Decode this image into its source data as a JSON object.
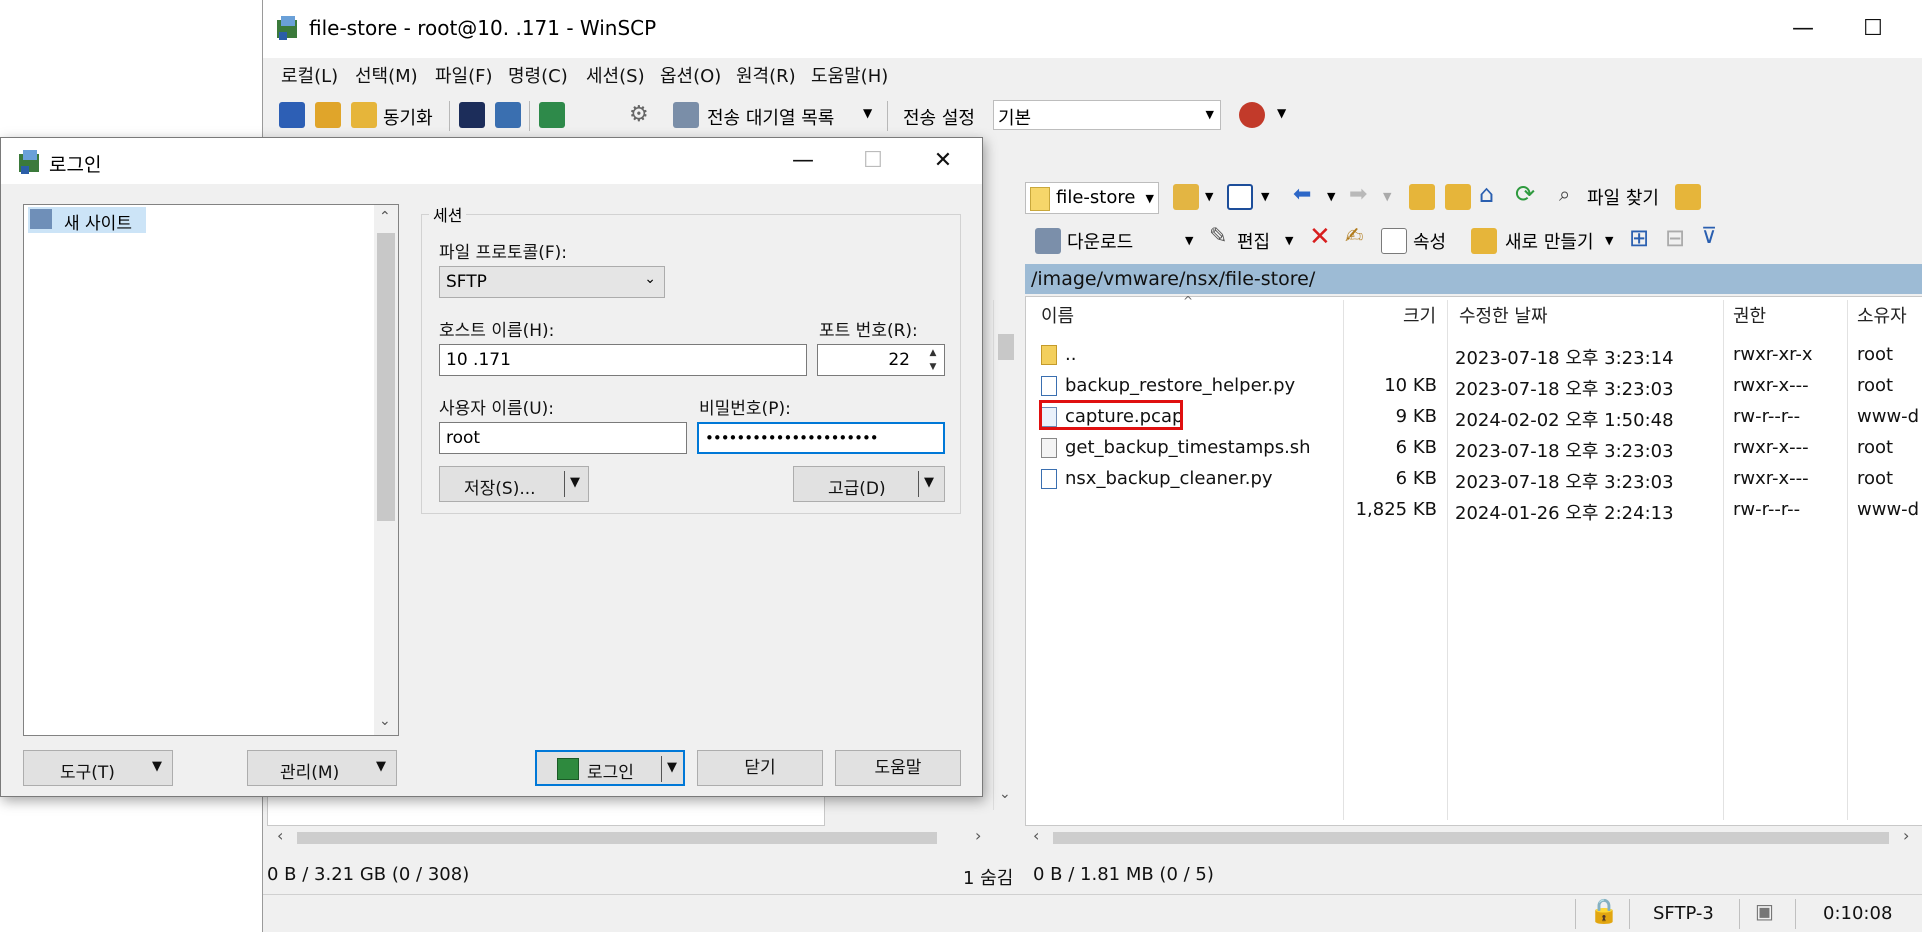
{
  "window": {
    "title": "file-store - root@10.          .171 - WinSCP",
    "minimize": "—",
    "maximize": "☐",
    "close": "✕"
  },
  "menu": [
    "로컬(L)",
    "선택(M)",
    "파일(F)",
    "명령(C)",
    "세션(S)",
    "옵션(O)",
    "원격(R)",
    "도움말(H)"
  ],
  "toolbar": {
    "sync_label": "동기화",
    "queue_label": "전송 대기열 목록",
    "transfer_settings_label": "전송 설정",
    "transfer_settings_value": "기본"
  },
  "remote": {
    "folder": "file-store",
    "find_files": "파일 찾기",
    "download": "다운로드",
    "edit": "편집",
    "properties": "속성",
    "new": "새로 만들기",
    "path": "/image/vmware/nsx/file-store/",
    "columns": {
      "name": "이름",
      "size": "크기",
      "modified": "수정한 날짜",
      "rights": "권한",
      "owner": "소유자"
    },
    "files": [
      {
        "name": "..",
        "size": "",
        "modified": "2023-07-18 오후 3:23:14",
        "rights": "rwxr-xr-x",
        "owner": "root",
        "icon": "parent-folder-icon"
      },
      {
        "name": "backup_restore_helper.py",
        "size": "10 KB",
        "modified": "2023-07-18 오후 3:23:03",
        "rights": "rwxr-x---",
        "owner": "root",
        "icon": "python-file-icon"
      },
      {
        "name": "capture.pcap",
        "size": "9 KB",
        "modified": "2024-02-02 오후 1:50:48",
        "rights": "rw-r--r--",
        "owner": "www-d",
        "icon": "binary-file-icon"
      },
      {
        "name": "get_backup_timestamps.sh",
        "size": "6 KB",
        "modified": "2023-07-18 오후 3:23:03",
        "rights": "rwxr-x---",
        "owner": "root",
        "icon": "shell-file-icon"
      },
      {
        "name": "nsx_backup_cleaner.py",
        "size": "6 KB",
        "modified": "2023-07-18 오후 3:23:03",
        "rights": "rwxr-x---",
        "owner": "root",
        "icon": "python-file-icon"
      },
      {
        "name": "",
        "size": "1,825 KB",
        "modified": "2024-01-26 오후 2:24:13",
        "rights": "rw-r--r--",
        "owner": "www-d",
        "icon": ""
      }
    ],
    "highlight_color": "#e01010",
    "status": "0 B / 1.81 MB (0 / 5)"
  },
  "local": {
    "status": "0 B / 3.21 GB (0 / 308)",
    "hidden": "1 숨김"
  },
  "statusbar": {
    "protocol": "SFTP-3",
    "time": "0:10:08"
  },
  "login": {
    "title": "로그인",
    "site_tree": [
      "새 사이트"
    ],
    "session_group": "세션",
    "protocol_label": "파일 프로토콜(F):",
    "protocol_value": "SFTP",
    "host_label": "호스트 이름(H):",
    "host_value": "10          .171",
    "port_label": "포트 번호(R):",
    "port_value": "22",
    "user_label": "사용자 이름(U):",
    "user_value": "root",
    "password_label": "비밀번호(P):",
    "password_value": "••••••••••••••••••••••",
    "save_btn": "저장(S)...",
    "advanced_btn": "고급(D)",
    "tools_btn": "도구(T)",
    "manage_btn": "관리(M)",
    "login_btn": "로그인",
    "close_btn": "닫기",
    "help_btn": "도움말"
  }
}
